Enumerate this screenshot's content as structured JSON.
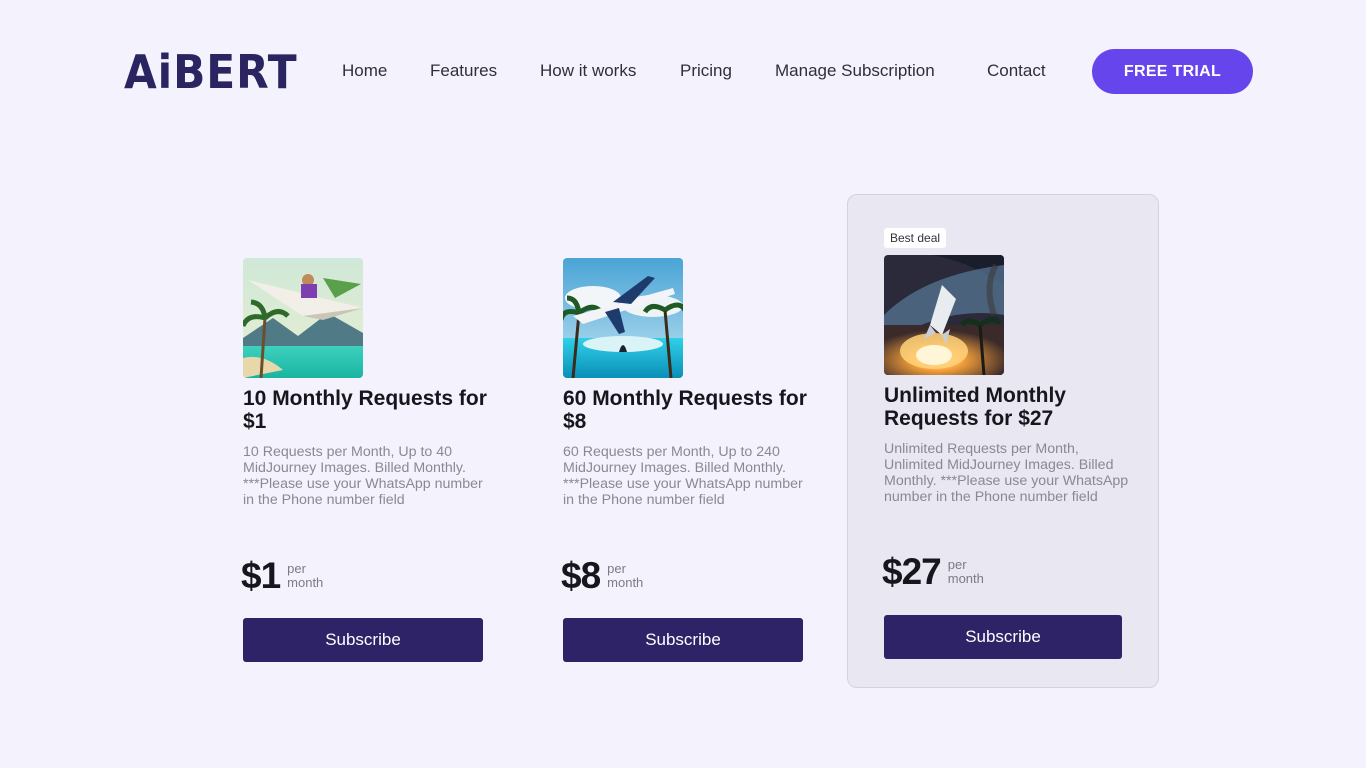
{
  "brand": {
    "logo_text": "AiBERT",
    "primary_color": "#6646ec",
    "button_color": "#2e2366"
  },
  "nav": {
    "items": [
      "Home",
      "Features",
      "How it works",
      "Pricing",
      "Manage Subscription",
      "Contact"
    ],
    "cta_label": "FREE TRIAL"
  },
  "plans": [
    {
      "title": "10 Monthly Requests for $1",
      "description": "10 Requests per Month, Up to 40 MidJourney Images. Billed Monthly. ***Please use your WhatsApp number in the Phone number field",
      "price": "$1",
      "per_line1": "per",
      "per_line2": "month",
      "button_label": "Subscribe",
      "image_icon": "paper-plane-beach-image"
    },
    {
      "title": "60 Monthly Requests for $8",
      "description": "60 Requests per Month, Up to 240 MidJourney Images. Billed Monthly. ***Please use your WhatsApp number in the Phone number field",
      "price": "$8",
      "per_line1": "per",
      "per_line2": "month",
      "button_label": "Subscribe",
      "image_icon": "airplane-island-image"
    },
    {
      "badge": "Best deal",
      "title": "Unlimited Monthly Requests for $27",
      "description": "Unlimited Requests per Month, Unlimited MidJourney Images. Billed Monthly. ***Please use your WhatsApp number in the Phone number field",
      "price": "$27",
      "per_line1": "per",
      "per_line2": "month",
      "button_label": "Subscribe",
      "image_icon": "rocket-launch-image"
    }
  ]
}
